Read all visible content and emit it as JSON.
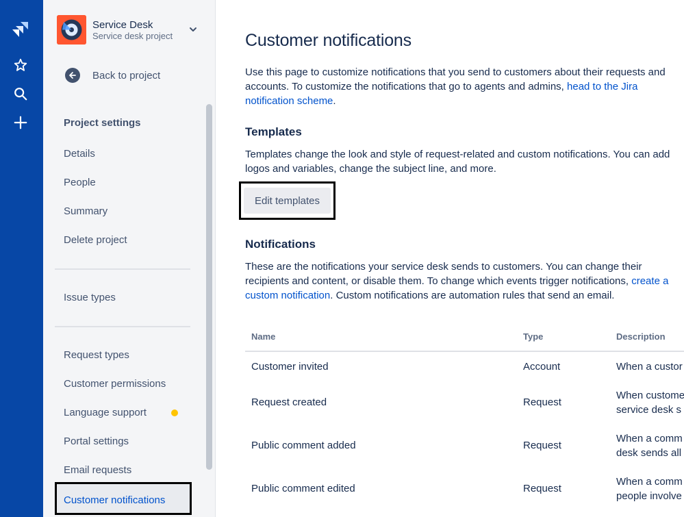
{
  "global_nav": {
    "icons": [
      "jira-logo-icon",
      "star-icon",
      "search-icon",
      "plus-icon"
    ]
  },
  "project": {
    "name": "Service Desk",
    "type": "Service desk project"
  },
  "sidebar": {
    "back_label": "Back to project",
    "heading": "Project settings",
    "group1": [
      "Details",
      "People",
      "Summary",
      "Delete project"
    ],
    "group2": [
      "Issue types"
    ],
    "group3": [
      "Request types",
      "Customer permissions",
      "Language support",
      "Portal settings",
      "Email requests"
    ],
    "active": "Customer notifications"
  },
  "main": {
    "title": "Customer notifications",
    "intro_text": "Use this page to customize notifications that you send to customers about their requests and accounts. To customize the notifications that go to agents and admins, ",
    "intro_link": "head to the Jira notification scheme",
    "intro_end": ".",
    "templates_heading": "Templates",
    "templates_text": "Templates change the look and style of request-related and custom notifications. You can add logos and variables, change the subject line, and more.",
    "edit_templates_button": "Edit templates",
    "notifications_heading": "Notifications",
    "notifications_text": "These are the notifications your service desk sends to customers. You can change their recipients and content, or disable them. To change which events trigger notifications, ",
    "notifications_link": "create a custom notification",
    "notifications_end": ". Custom notifications are automation rules that send an email.",
    "table": {
      "headers": [
        "Name",
        "Type",
        "Description"
      ],
      "rows": [
        {
          "name": "Customer invited",
          "type": "Account",
          "desc": [
            "When a custor"
          ]
        },
        {
          "name": "Request created",
          "type": "Request",
          "desc": [
            "When custome",
            "service desk s"
          ]
        },
        {
          "name": "Public comment added",
          "type": "Request",
          "desc": [
            "When a comm",
            "desk sends all"
          ]
        },
        {
          "name": "Public comment edited",
          "type": "Request",
          "desc": [
            "When a comm",
            "people involve"
          ]
        }
      ]
    }
  },
  "colors": {
    "nav": "#0747A6",
    "sidebar_bg": "#F4F5F7",
    "link": "#0052CC",
    "dot": "#FFC400",
    "avatar": "#FF5630"
  }
}
